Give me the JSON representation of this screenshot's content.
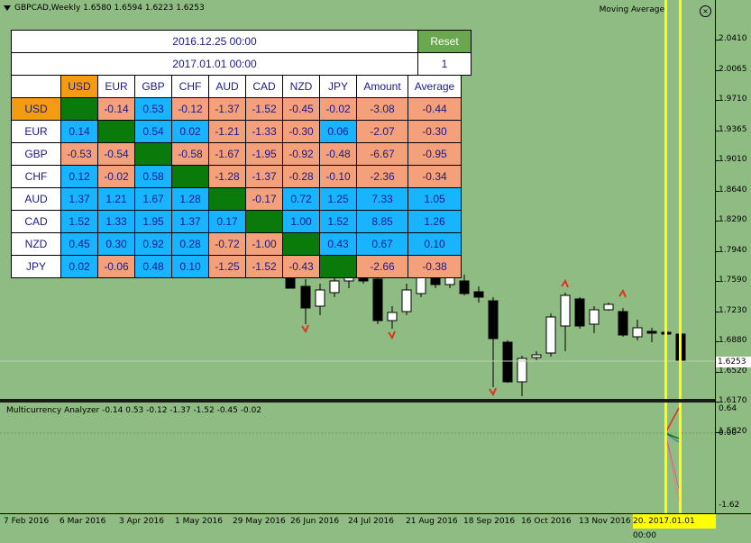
{
  "window": {
    "title": "GBPCAD,Weekly  1.6580 1.6594 1.6223 1.6253",
    "indicator_name": "Moving Average"
  },
  "subwindow": {
    "title": "Multicurrency Analyzer -0.14 0.53 -0.12 -1.37 -1.52 -0.45 -0.02",
    "scale": [
      "0.64",
      "0.00",
      "-1.62"
    ]
  },
  "price_axis": {
    "labels": [
      "2.0410",
      "2.0065",
      "1.9710",
      "1.9365",
      "1.9010",
      "1.8640",
      "1.8290",
      "1.7940",
      "1.7590",
      "1.7230",
      "1.6880",
      "1.6520",
      "1.6170",
      "1.5820"
    ],
    "current": "1.6253"
  },
  "time_axis": {
    "labels": [
      "7 Feb 2016",
      "6 Mar 2016",
      "3 Apr 2016",
      "1 May 2016",
      "29 May 2016",
      "26 Jun 2016",
      "24 Jul 2016",
      "21 Aug 2016",
      "18 Sep 2016",
      "16 Oct 2016",
      "13 Nov 2016"
    ],
    "highlight": "20. 2017.01.01 00:00"
  },
  "panel": {
    "date_from": "2016.12.25 00:00",
    "date_to": "2017.01.01 00:00",
    "reset_label": "Reset",
    "count": "1",
    "columns": [
      "USD",
      "EUR",
      "GBP",
      "CHF",
      "AUD",
      "CAD",
      "NZD",
      "JPY",
      "Amount",
      "Average"
    ],
    "rows": [
      {
        "label": "USD",
        "values": [
          "",
          "-0.14",
          "0.53",
          "-0.12",
          "-1.37",
          "-1.52",
          "-0.45",
          "-0.02",
          "-3.08",
          "-0.44"
        ]
      },
      {
        "label": "EUR",
        "values": [
          "0.14",
          "",
          "0.54",
          "0.02",
          "-1.21",
          "-1.33",
          "-0.30",
          "0.06",
          "-2.07",
          "-0.30"
        ]
      },
      {
        "label": "GBP",
        "values": [
          "-0.53",
          "-0.54",
          "",
          "-0.58",
          "-1.67",
          "-1.95",
          "-0.92",
          "-0.48",
          "-6.67",
          "-0.95"
        ]
      },
      {
        "label": "CHF",
        "values": [
          "0.12",
          "-0.02",
          "0.58",
          "",
          "-1.28",
          "-1.37",
          "-0.28",
          "-0.10",
          "-2.36",
          "-0.34"
        ]
      },
      {
        "label": "AUD",
        "values": [
          "1.37",
          "1.21",
          "1.67",
          "1.28",
          "",
          "-0.17",
          "0.72",
          "1.25",
          "7.33",
          "1.05"
        ]
      },
      {
        "label": "CAD",
        "values": [
          "1.52",
          "1.33",
          "1.95",
          "1.37",
          "0.17",
          "",
          "1.00",
          "1.52",
          "8.85",
          "1.26"
        ]
      },
      {
        "label": "NZD",
        "values": [
          "0.45",
          "0.30",
          "0.92",
          "0.28",
          "-0.72",
          "-1.00",
          "",
          "0.43",
          "0.67",
          "0.10"
        ]
      },
      {
        "label": "JPY",
        "values": [
          "0.02",
          "-0.06",
          "0.48",
          "0.10",
          "-1.25",
          "-1.52",
          "-0.43",
          "",
          "-2.66",
          "-0.38"
        ]
      }
    ]
  },
  "colors": {
    "background": "#8fbc82",
    "positive": "#19b4ff",
    "negative": "#f4a07a",
    "diagonal": "#0a7a0a",
    "usd_highlight": "#f39c12",
    "marker": "#ffff00"
  }
}
